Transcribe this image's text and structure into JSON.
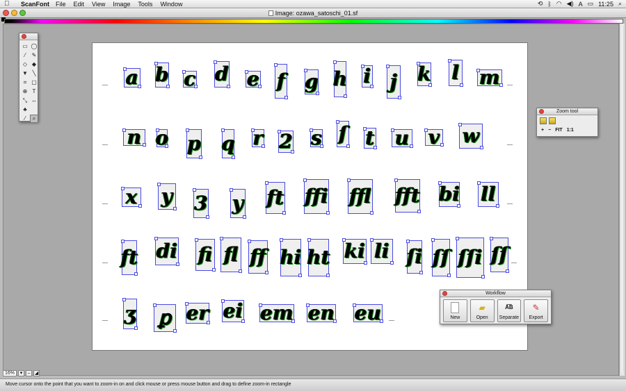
{
  "menubar": {
    "app": "ScanFont",
    "items": [
      "File",
      "Edit",
      "View",
      "Image",
      "Tools",
      "Window"
    ],
    "clock": "11:25"
  },
  "window": {
    "title": "Image: ozawa_satoschi_01.sf"
  },
  "glyphs": [
    {
      "ch": "a",
      "row": 0
    },
    {
      "ch": "b",
      "row": 0
    },
    {
      "ch": "c",
      "row": 0
    },
    {
      "ch": "d",
      "row": 0
    },
    {
      "ch": "e",
      "row": 0
    },
    {
      "ch": "f",
      "row": 0
    },
    {
      "ch": "g",
      "row": 0
    },
    {
      "ch": "h",
      "row": 0
    },
    {
      "ch": "i",
      "row": 0
    },
    {
      "ch": "j",
      "row": 0
    },
    {
      "ch": "k",
      "row": 0
    },
    {
      "ch": "l",
      "row": 0
    },
    {
      "ch": "m",
      "row": 0
    },
    {
      "ch": "n",
      "row": 1
    },
    {
      "ch": "o",
      "row": 1
    },
    {
      "ch": "p",
      "row": 1
    },
    {
      "ch": "q",
      "row": 1
    },
    {
      "ch": "r",
      "row": 1
    },
    {
      "ch": "2",
      "row": 1
    },
    {
      "ch": "s",
      "row": 1
    },
    {
      "ch": "ſ",
      "row": 1
    },
    {
      "ch": "t",
      "row": 1
    },
    {
      "ch": "u",
      "row": 1
    },
    {
      "ch": "v",
      "row": 1
    },
    {
      "ch": "w",
      "row": 1
    },
    {
      "ch": "x",
      "row": 2
    },
    {
      "ch": "y",
      "row": 2
    },
    {
      "ch": "3",
      "row": 2
    },
    {
      "ch": "y",
      "row": 2
    },
    {
      "ch": "ft",
      "row": 2
    },
    {
      "ch": "ffi",
      "row": 2
    },
    {
      "ch": "ffl",
      "row": 2
    },
    {
      "ch": "fft",
      "row": 2
    },
    {
      "ch": "bi",
      "row": 2
    },
    {
      "ch": "ll",
      "row": 2
    },
    {
      "ch": "ft",
      "row": 3
    },
    {
      "ch": "di",
      "row": 3
    },
    {
      "ch": "fi",
      "row": 3
    },
    {
      "ch": "fl",
      "row": 3
    },
    {
      "ch": "ff",
      "row": 3
    },
    {
      "ch": "hi",
      "row": 3
    },
    {
      "ch": "ht",
      "row": 3
    },
    {
      "ch": "ki",
      "row": 3
    },
    {
      "ch": "li",
      "row": 3
    },
    {
      "ch": "ſi",
      "row": 3
    },
    {
      "ch": "ſſ",
      "row": 3
    },
    {
      "ch": "ſſi",
      "row": 3
    },
    {
      "ch": "ſſ",
      "row": 3
    },
    {
      "ch": "ʒ",
      "row": 4
    },
    {
      "ch": "ꝑ",
      "row": 4
    },
    {
      "ch": "er",
      "row": 4
    },
    {
      "ch": "ei",
      "row": 4
    },
    {
      "ch": "em",
      "row": 4
    },
    {
      "ch": "en",
      "row": 4
    },
    {
      "ch": "eu",
      "row": 4
    }
  ],
  "tools_panel": {
    "tools": [
      "rect-select-icon",
      "lasso-icon",
      "wand-icon",
      "pen-icon",
      "eraser-icon",
      "bucket-icon",
      "fill-icon",
      "line-icon",
      "crop-icon",
      "shape-icon",
      "crosshair-icon",
      "text-icon",
      "transform-icon",
      "measure-icon",
      "stamp-icon",
      "",
      "eyedropper-icon",
      "zoom-icon"
    ]
  },
  "zoom_tool": {
    "title": "Zoom tool",
    "plus": "+",
    "minus": "−",
    "fit": "FIT",
    "one_to_one": "1:1"
  },
  "workflow": {
    "title": "Workflow",
    "buttons": [
      {
        "label": "New",
        "icon": "new-document-icon"
      },
      {
        "label": "Open",
        "icon": "open-folder-icon"
      },
      {
        "label": "Separate",
        "icon": "separate-icon"
      },
      {
        "label": "Export",
        "icon": "export-icon"
      }
    ]
  },
  "bottom": {
    "zoom": "16%"
  },
  "status": "Move cursor onto the point that you want to zoom-in on and click mouse or press mouse button and drag to define zoom-in rectangle"
}
